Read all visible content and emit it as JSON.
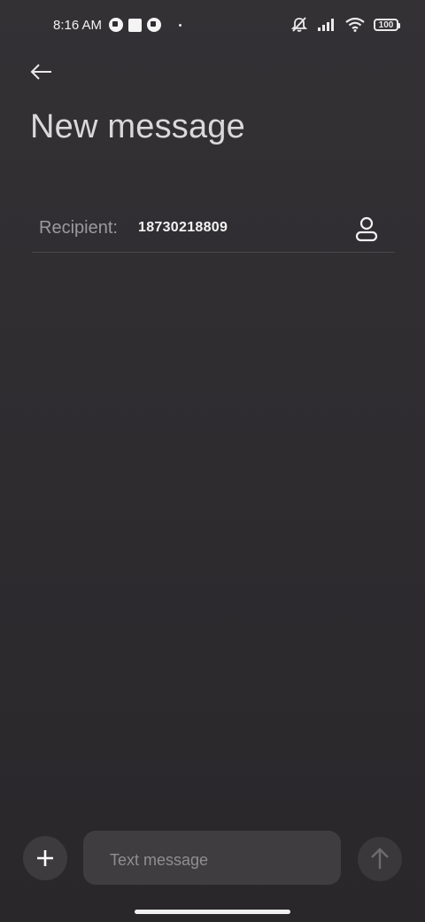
{
  "status_bar": {
    "time": "8:16 AM",
    "battery_level": "100",
    "icons": [
      "app-icon-1",
      "stop-icon",
      "app-icon-2",
      "dot-icon",
      "mute-icon",
      "signal-icon",
      "wifi-icon",
      "battery-icon"
    ]
  },
  "header": {
    "back_icon": "back-arrow-icon",
    "title": "New message"
  },
  "recipient": {
    "label": "Recipient:",
    "value": "18730218809",
    "contact_icon": "person-icon"
  },
  "composer": {
    "add_icon": "plus-icon",
    "placeholder": "Text message",
    "value": "",
    "send_icon": "send-arrow-icon"
  },
  "colors": {
    "background": "#2f2d30",
    "title_text": "#d9d9d9",
    "label_text": "#9a999b",
    "input_bg": "#3f3d40",
    "button_bg": "#3d3b3e"
  }
}
